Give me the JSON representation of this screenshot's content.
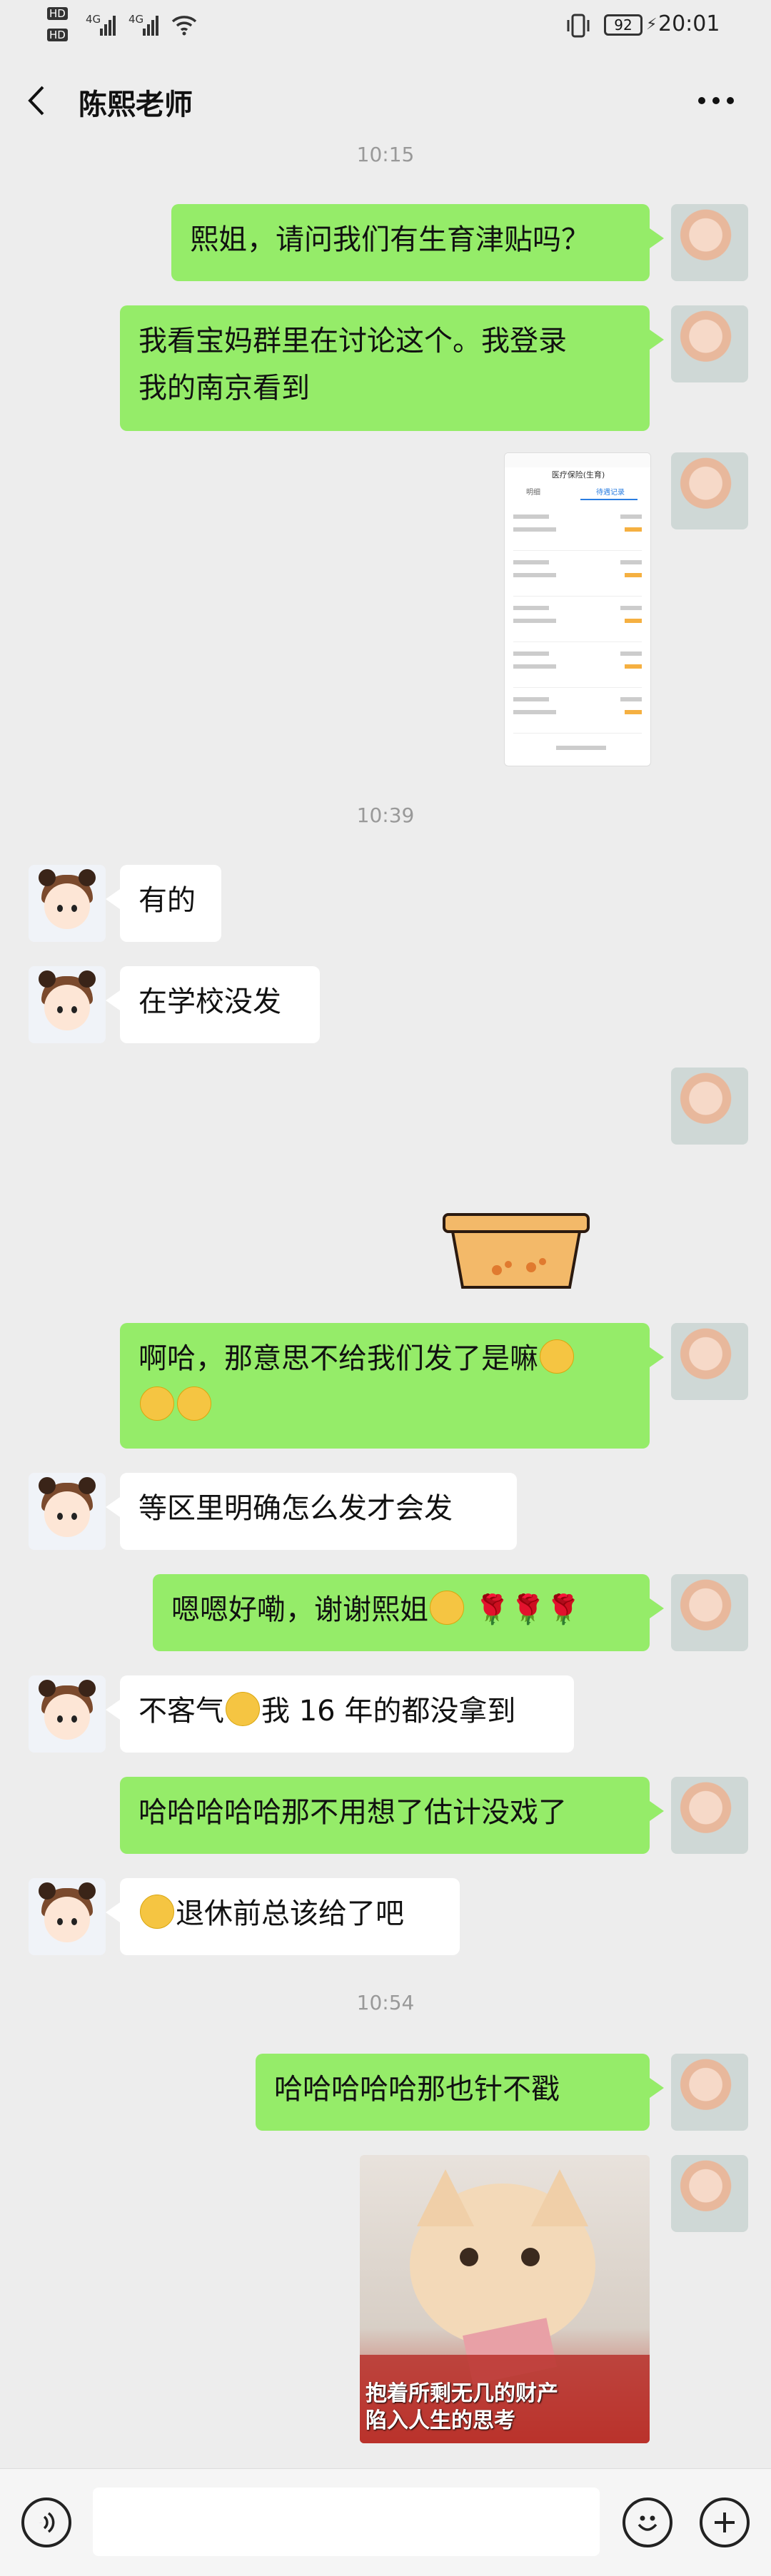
{
  "status_bar": {
    "hd_label": "HD",
    "network": "4G",
    "battery": "92",
    "time": "20:01"
  },
  "header": {
    "title": "陈熙老师",
    "back_icon": "chevron-left-icon",
    "more_icon": "ellipsis-icon"
  },
  "timestamps": [
    "10:15",
    "10:39",
    "10:54"
  ],
  "messages": [
    {
      "from": "me",
      "text": "熙姐，请问我们有生育津贴吗？"
    },
    {
      "from": "me",
      "text_line1": "我看宝妈群里在讨论这个。我登录",
      "text_line2": "我的南京看到"
    },
    {
      "from": "me",
      "type": "image",
      "desc": "screenshot"
    },
    {
      "from": "other",
      "text": "有的"
    },
    {
      "from": "other",
      "text": "在学校没发"
    },
    {
      "from": "me",
      "type": "sticker"
    },
    {
      "from": "me",
      "text_line1": "啊哈，那意思不给我们发了是嘛",
      "emoji": "tears-of-joy"
    },
    {
      "from": "other",
      "text": "等区里明确怎么发才会发"
    },
    {
      "from": "me",
      "text": "嗯嗯好嘞，谢谢熙姐"
    },
    {
      "from": "other",
      "text_a": "不客气",
      "text_b": "我 16 年的都没拿到"
    },
    {
      "from": "me",
      "text": "哈哈哈哈哈那不用想了估计没戏了"
    },
    {
      "from": "other",
      "text": "退休前总该给了吧"
    },
    {
      "from": "me",
      "text": "哈哈哈哈哈那也针不戳"
    },
    {
      "from": "me",
      "type": "image",
      "caption_line1": "抱着所剩无几的财产",
      "caption_line2": "陷入人生的思考"
    }
  ],
  "thumb": {
    "title": "医疗保险(生育)",
    "tab_left": "明细",
    "tab_right": "待遇记录"
  },
  "bottom_bar": {
    "voice_icon": "voice-icon",
    "emoji_icon": "emoji-icon",
    "plus_icon": "plus-icon"
  },
  "colors": {
    "background": "#ededed",
    "my_bubble": "#95ec69",
    "their_bubble": "#ffffff"
  }
}
